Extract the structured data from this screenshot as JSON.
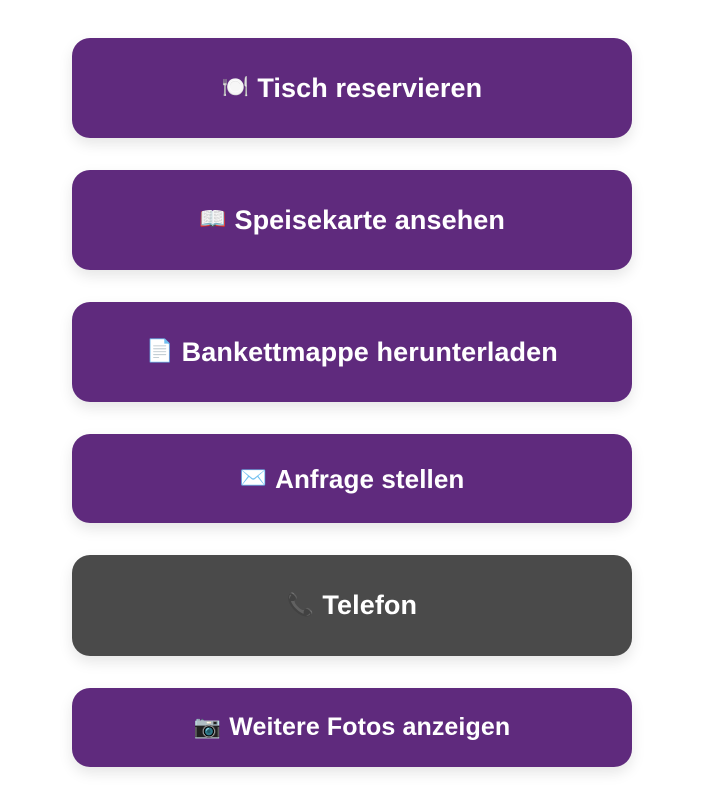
{
  "colors": {
    "primary": "#5F2A7D",
    "secondary": "#4A4A4A",
    "text": "#FFFFFF",
    "background": "#FFFFFF"
  },
  "buttons": [
    {
      "icon_name": "plate-cutlery-icon",
      "icon": "🍽️",
      "label": "Tisch reservieren",
      "variant": "primary"
    },
    {
      "icon_name": "open-book-icon",
      "icon": "📖",
      "label": "Speisekarte ansehen",
      "variant": "primary"
    },
    {
      "icon_name": "document-icon",
      "icon": "📄",
      "label": "Bankettmappe herunterladen",
      "variant": "primary"
    },
    {
      "icon_name": "envelope-icon",
      "icon": "✉️",
      "label": "Anfrage stellen",
      "variant": "primary"
    },
    {
      "icon_name": "phone-icon",
      "icon": "📞",
      "label": "Telefon",
      "variant": "secondary"
    },
    {
      "icon_name": "camera-icon",
      "icon": "📷",
      "label": "Weitere Fotos anzeigen",
      "variant": "primary"
    }
  ]
}
